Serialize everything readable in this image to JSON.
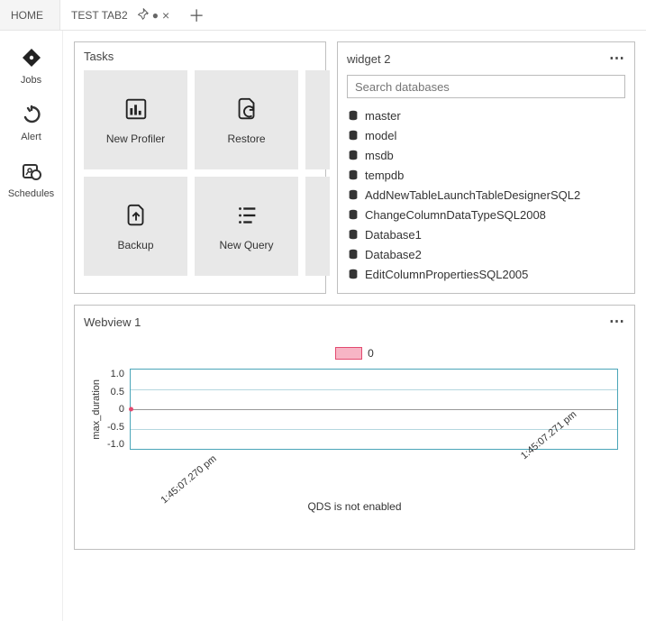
{
  "tabs": {
    "home": "HOME",
    "active": "TEST TAB2"
  },
  "rail": {
    "jobs": "Jobs",
    "alert": "Alert",
    "schedules": "Schedules"
  },
  "tasks": {
    "title": "Tasks",
    "new_profiler": "New Profiler",
    "restore": "Restore",
    "backup": "Backup",
    "new_query": "New Query"
  },
  "widget2": {
    "title": "widget 2",
    "search_placeholder": "Search databases",
    "items": {
      "0": "master",
      "1": "model",
      "2": "msdb",
      "3": "tempdb",
      "4": "AddNewTableLaunchTableDesignerSQL2",
      "5": "ChangeColumnDataTypeSQL2008",
      "6": "Database1",
      "7": "Database2",
      "8": "EditColumnPropertiesSQL2005"
    }
  },
  "webview": {
    "title": "Webview 1",
    "legend_label": "0",
    "ylabel": "max_duration",
    "yticks": {
      "0": "1.0",
      "1": "0.5",
      "2": "0",
      "3": "-0.5",
      "4": "-1.0"
    },
    "xticks": {
      "0": "1:45:07.270 pm",
      "1": "1:45:07.271 pm"
    },
    "message": "QDS is not enabled"
  },
  "chart_data": {
    "type": "line",
    "series": [
      {
        "name": "0",
        "values": [
          0
        ],
        "color": "#e34a6f"
      }
    ],
    "x": [
      "1:45:07.270 pm"
    ],
    "x_range": [
      "1:45:07.270 pm",
      "1:45:07.271 pm"
    ],
    "ylabel": "max_duration",
    "ylim": [
      -1.0,
      1.0
    ],
    "yticks": [
      -1.0,
      -0.5,
      0,
      0.5,
      1.0
    ],
    "grid": true,
    "legend_position": "top",
    "annotation": "QDS is not enabled"
  }
}
